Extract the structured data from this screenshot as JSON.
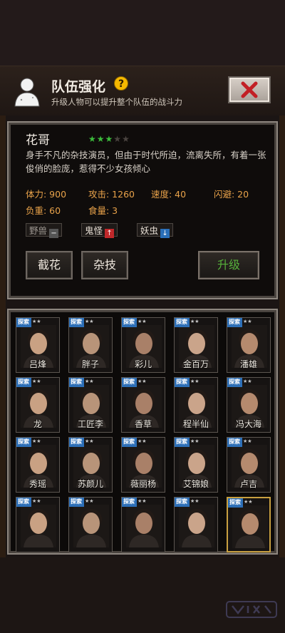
{
  "header": {
    "title": "队伍强化",
    "help_label": "?",
    "subtitle": "升级人物可以提升整个队伍的战斗力"
  },
  "character": {
    "name": "花哥",
    "stars_total": 5,
    "stars_filled": 3,
    "description": "身手不凡的杂技演员，但由于时代所迫，流离失所，有着一张俊俏的脸庞，惹得不少女孩倾心",
    "stats": {
      "hp": "体力: 900",
      "attack": "攻击: 1260",
      "speed": "速度: 40",
      "dodge": "闪避: 20",
      "load": "负重: 60",
      "food": "食量: 3"
    },
    "affinities": [
      {
        "label": "野兽",
        "arrow": "−",
        "color": "#555555"
      },
      {
        "label": "鬼怪",
        "arrow": "↑",
        "color": "#c0282a"
      },
      {
        "label": "妖虫",
        "arrow": "↓",
        "color": "#2a6fb8"
      }
    ]
  },
  "actions": {
    "skill1": "截花",
    "skill2": "杂技",
    "upgrade": "升级"
  },
  "roster": {
    "tag": "探索",
    "members": [
      {
        "name": "吕烽",
        "stars": "★★"
      },
      {
        "name": "胖子",
        "stars": "★★"
      },
      {
        "name": "彩儿",
        "stars": "★★"
      },
      {
        "name": "金百万",
        "stars": "★★"
      },
      {
        "name": "潘雄",
        "stars": "★★"
      },
      {
        "name": "龙",
        "stars": "★★"
      },
      {
        "name": "工匠李",
        "stars": "★★"
      },
      {
        "name": "香草",
        "stars": "★★"
      },
      {
        "name": "程半仙",
        "stars": "★★"
      },
      {
        "name": "冯大海",
        "stars": "★★"
      },
      {
        "name": "秀瑶",
        "stars": "★★"
      },
      {
        "name": "苏颜儿",
        "stars": "★★"
      },
      {
        "name": "薇丽杨",
        "stars": "★★"
      },
      {
        "name": "艾锦娘",
        "stars": "★★"
      },
      {
        "name": "卢吉",
        "stars": "★★"
      },
      {
        "name": "",
        "stars": "★★"
      },
      {
        "name": "",
        "stars": "★★"
      },
      {
        "name": "",
        "stars": "★★"
      },
      {
        "name": "",
        "stars": "★★"
      },
      {
        "name": "",
        "stars": "★★"
      }
    ]
  },
  "colors": {
    "accent_green": "#56b13b",
    "stat_orange": "#e8a24a",
    "tag_blue": "#2d6fb7"
  }
}
